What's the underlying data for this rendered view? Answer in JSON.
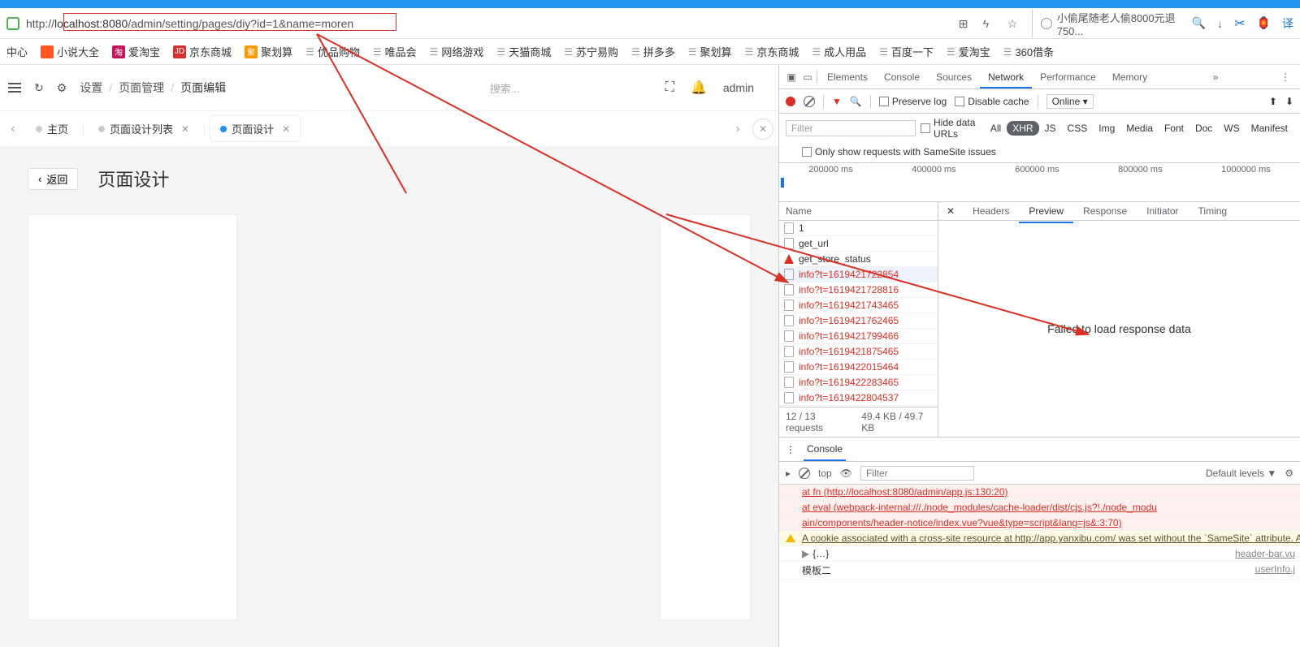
{
  "url": {
    "scheme": "http://",
    "host": "localhost:8080",
    "path": "/admin/setting/pages/diy?id=1&name=moren"
  },
  "browser_search": {
    "placeholder": "小偷尾随老人偷8000元退750..."
  },
  "bookmarks": [
    {
      "label": "中心"
    },
    {
      "label": "小说大全",
      "bg": "bm-orange"
    },
    {
      "label": "爱淘宝",
      "bg": "bm-pink",
      "ico_text": "淘"
    },
    {
      "label": "京东商城",
      "bg": "bm-red",
      "ico_text": "JD"
    },
    {
      "label": "聚划算",
      "bg": "bm-yellow",
      "ico_text": "聚"
    },
    {
      "label": "优品购物",
      "doc": true
    },
    {
      "label": "唯品会",
      "doc": true
    },
    {
      "label": "网络游戏",
      "doc": true
    },
    {
      "label": "天猫商城",
      "doc": true
    },
    {
      "label": "苏宁易购",
      "doc": true
    },
    {
      "label": "拼多多",
      "doc": true
    },
    {
      "label": "聚划算",
      "doc": true
    },
    {
      "label": "京东商城",
      "doc": true
    },
    {
      "label": "成人用品",
      "doc": true
    },
    {
      "label": "百度一下",
      "doc": true
    },
    {
      "label": "爱淘宝",
      "doc": true
    },
    {
      "label": "360借条",
      "doc": true
    }
  ],
  "breadcrumb": {
    "item1": "设置",
    "item2": "页面管理",
    "item3": "页面编辑"
  },
  "app_search_placeholder": "搜索...",
  "app_user": "admin",
  "tabs": {
    "home": "主页",
    "list": "页面设计列表",
    "design": "页面设计"
  },
  "page": {
    "back": "返回",
    "title": "页面设计"
  },
  "devtools": {
    "top_tabs": [
      "Elements",
      "Console",
      "Sources",
      "Network",
      "Performance",
      "Memory"
    ],
    "active_top_tab": "Network",
    "toolbar": {
      "preserve_log": "Preserve log",
      "disable_cache": "Disable cache",
      "throttle": "Online"
    },
    "filter": {
      "placeholder": "Filter",
      "hide_data_urls": "Hide data URLs",
      "chips": [
        "All",
        "XHR",
        "JS",
        "CSS",
        "Img",
        "Media",
        "Font",
        "Doc",
        "WS",
        "Manifest"
      ],
      "only_samesite": "Only show requests with SameSite issues"
    },
    "timeline_labels": [
      "200000 ms",
      "400000 ms",
      "600000 ms",
      "800000 ms",
      "1000000 ms"
    ],
    "name_header": "Name",
    "requests": [
      {
        "name": "1",
        "err": false
      },
      {
        "name": "get_url",
        "err": false
      },
      {
        "name": "get_store_status",
        "err": false,
        "tri": true
      },
      {
        "name": "info?t=1619421722854",
        "err": true,
        "sel": true
      },
      {
        "name": "info?t=1619421728816",
        "err": true
      },
      {
        "name": "info?t=1619421743465",
        "err": true
      },
      {
        "name": "info?t=1619421762465",
        "err": true
      },
      {
        "name": "info?t=1619421799466",
        "err": true
      },
      {
        "name": "info?t=1619421875465",
        "err": true
      },
      {
        "name": "info?t=1619422015464",
        "err": true
      },
      {
        "name": "info?t=1619422283465",
        "err": true
      },
      {
        "name": "info?t=1619422804537",
        "err": true
      }
    ],
    "status_bar": {
      "requests": "12 / 13 requests",
      "transfer": "49.4 KB / 49.7 KB"
    },
    "preview_tabs": [
      "Headers",
      "Preview",
      "Response",
      "Initiator",
      "Timing"
    ],
    "active_preview_tab": "Preview",
    "preview_body": "Failed to load response data",
    "console": {
      "label": "Console",
      "context": "top",
      "filter_placeholder": "Filter",
      "levels": "Default levels ▼",
      "lines": [
        {
          "type": "err",
          "indent": true,
          "text": "at fn (http://localhost:8080/admin/app.js:130:20)"
        },
        {
          "type": "err",
          "indent": true,
          "text": "at eval (webpack-internal:///./node_modules/cache-loader/dist/cjs.js?!./node_modu"
        },
        {
          "type": "err",
          "indent": false,
          "text": "ain/components/header-notice/index.vue?vue&type=script&lang=js&:3:70)"
        },
        {
          "type": "warn",
          "text": "A cookie associated with a cross-site resource at http://app.yanxibu.com/ was set without the `SameSite` attribute. A future release of Chrome will only deliver cookie cross-site requests if they are set with `SameSite=None` and `Secure`. You can review in developer tools under Application>Storage>Cookies and see more details at https://status.com/feature/5088147346030592 and https://www.chromestatus.com/feature/56335216"
        },
        {
          "type": "obj",
          "text": "{…}",
          "right": "header-bar.vu"
        },
        {
          "type": "plain",
          "text": "模板二",
          "right": "userInfo.j"
        }
      ]
    }
  }
}
